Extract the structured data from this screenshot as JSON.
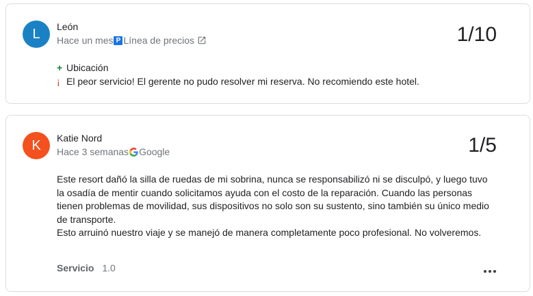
{
  "reviews": [
    {
      "avatar_letter": "L",
      "avatar_color": "#1a82c4",
      "author": "León",
      "time": "Hace un mes",
      "source_badge": "P",
      "source_name": "Línea de precios",
      "source_icon": "external-link-icon",
      "rating": "1/10",
      "positive_label": "+",
      "positive_text": "Ubicación",
      "negative_label": "¡",
      "negative_text": "El peor servicio! El gerente no pudo resolver mi reserva. No recomiendo este hotel."
    },
    {
      "avatar_letter": "K",
      "avatar_color": "#f4511e",
      "author": "Katie Nord",
      "time": "Hace 3 semanas",
      "source_icon": "google-icon",
      "source_name": "Google",
      "rating": "1/5",
      "text_p1": "Este resort dañó la silla de ruedas de mi sobrina, nunca se responsabilizó ni se disculpó, y luego tuvo la osadía de mentir cuando solicitamos ayuda con el costo de la reparación. Cuando las personas tienen problemas de movilidad, sus dispositivos no solo son su sustento, sino también su único medio de transporte.",
      "text_p2": "Esto arruinó nuestro viaje y se manejó de manera completamente poco profesional. No volveremos.",
      "aspect_name": "Servicio",
      "aspect_score": "1.0",
      "more_icon": "more-horizontal-icon"
    }
  ]
}
